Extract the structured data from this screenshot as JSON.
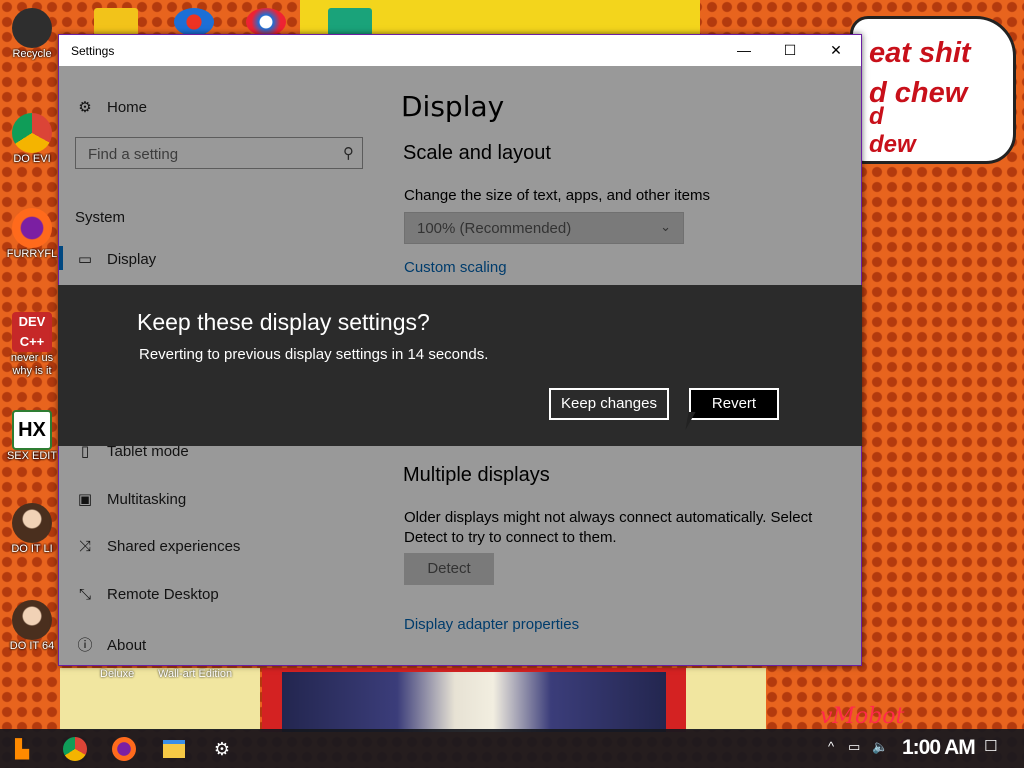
{
  "desktop": {
    "icons": [
      {
        "label": "Recycle",
        "icon": "recycle-bin-icon",
        "color": "#2e2e2e"
      },
      {
        "label": "DO EVI",
        "icon": "chrome-icon",
        "color": "#1a73e8"
      },
      {
        "label": "FURRYFL",
        "icon": "firefox-icon",
        "color": "#ff6a1c"
      },
      {
        "label": "never us",
        "label2": "why is it",
        "icon": "devcpp-icon",
        "color": "#c62828"
      },
      {
        "label": "SEX EDIT",
        "icon": "hxd-icon",
        "color": "#2e7d32"
      },
      {
        "label": "DO IT LI",
        "icon": "portrait-icon",
        "color": "#8d5a3b"
      },
      {
        "label": "DO IT 64",
        "icon": "portrait-icon",
        "color": "#8d5a3b"
      }
    ],
    "wallpaper": {
      "bubble_lines": [
        "eat shit",
        "d chew",
        "d",
        "dew"
      ],
      "caption_left": "Deluxe",
      "caption_right": "Wall-art Edition",
      "signature": "vMobot"
    }
  },
  "window": {
    "title": "Settings",
    "controls": {
      "minimize": "—",
      "maximize": "☐",
      "close": "✕"
    }
  },
  "sidebar": {
    "home": "Home",
    "search_placeholder": "Find a setting",
    "section": "System",
    "items": [
      {
        "label": "Display",
        "icon": "monitor-icon",
        "selected": true
      },
      {
        "label": "Tablet mode",
        "icon": "tablet-icon"
      },
      {
        "label": "Multitasking",
        "icon": "multitasking-icon"
      },
      {
        "label": "Shared experiences",
        "icon": "shared-experiences-icon"
      },
      {
        "label": "Remote Desktop",
        "icon": "remote-desktop-icon"
      },
      {
        "label": "About",
        "icon": "info-icon"
      }
    ]
  },
  "main": {
    "title": "Display",
    "scale_heading": "Scale and layout",
    "scale_desc": "Change the size of text, apps, and other items",
    "scale_value": "100% (Recommended)",
    "custom_scaling": "Custom scaling",
    "multi_heading": "Multiple displays",
    "multi_desc_1": "Older displays might not always connect automatically. Select",
    "multi_desc_2": "Detect to try to connect to them.",
    "detect_button": "Detect",
    "adapter_link": "Display adapter properties"
  },
  "dialog": {
    "title": "Keep these display settings?",
    "message": "Reverting to previous display settings in 14 seconds.",
    "keep_label": "Keep changes",
    "revert_label": "Revert"
  },
  "taskbar": {
    "clock": "1:00 AM",
    "tray_chevron": "^",
    "colors": {
      "bar": "#16181e",
      "accent": "#0078d7"
    }
  }
}
